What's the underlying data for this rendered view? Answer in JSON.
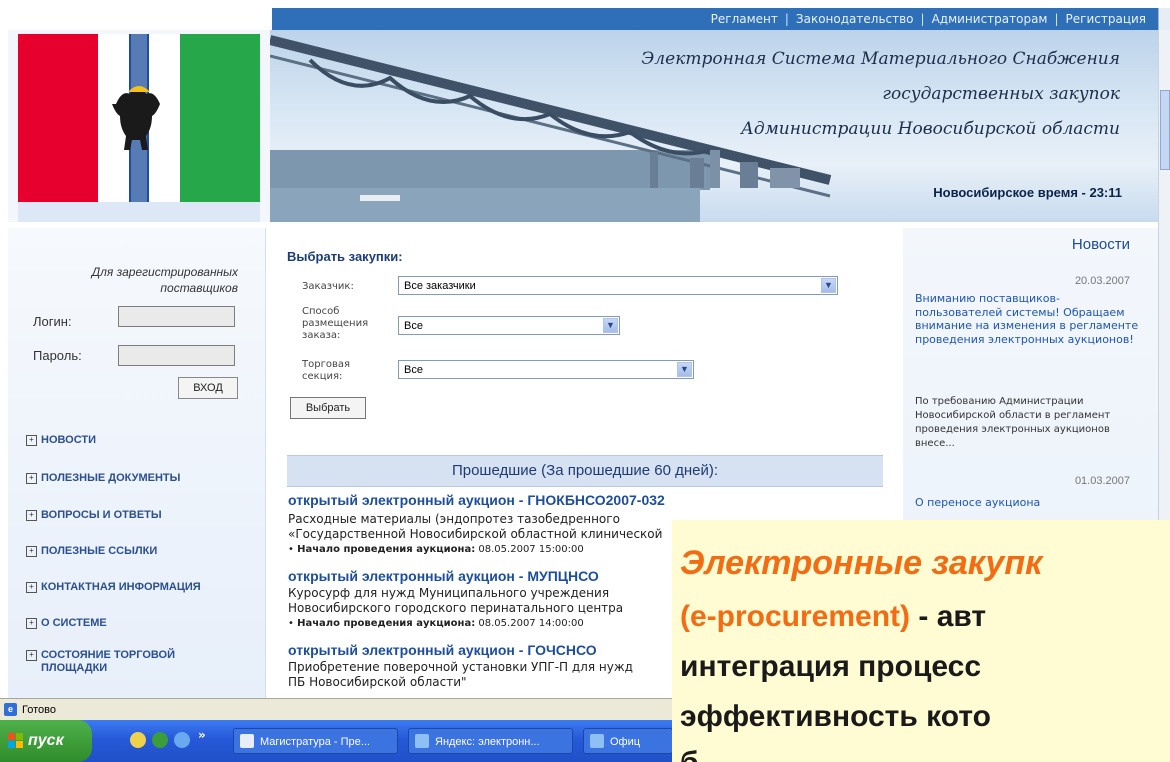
{
  "nav": {
    "links": [
      "Регламент",
      "Законодательство",
      "Администраторам",
      "Регистрация"
    ],
    "separator": "|"
  },
  "header": {
    "line1": "Электронная Система Материального Снабжения",
    "line2": "государственных закупок",
    "line3": "Администрации Новосибирской области",
    "clock": "Новосибирское время - 23:11"
  },
  "login": {
    "note": "Для зарегистрированных поставщиков",
    "login_label": "Логин:",
    "password_label": "Пароль:",
    "login_value": "",
    "password_value": "",
    "enter_button": "ВХОД"
  },
  "menu": [
    "НОВОСТИ",
    "ПОЛЕЗНЫЕ ДОКУМЕНТЫ",
    "ВОПРОСЫ И ОТВЕТЫ",
    "ПОЛЕЗНЫЕ ССЫЛКИ",
    "КОНТАКТНАЯ ИНФОРМАЦИЯ",
    "О СИСТЕМЕ",
    "СОСТОЯНИЕ ТОРГОВОЙ ПЛОЩАДКИ"
  ],
  "filter": {
    "title": "Выбрать закупки:",
    "customer_label": "Заказчик:",
    "customer_value": "Все заказчики",
    "method_label": "Способ размещения заказа:",
    "method_value": "Все",
    "section_label": "Торговая секция:",
    "section_value": "Все",
    "choose_button": "Выбрать"
  },
  "past": {
    "heading": "Прошедшие (За прошедшие 60 дней):",
    "start_label": "Начало проведения аукциона:",
    "auctions": [
      {
        "title": "открытый электронный аукцион - ГНОКБНСО2007-032",
        "desc1": "Расходные материалы (эндопротез тазобедренного",
        "desc2": "«Государственной Новосибирской областной клинической",
        "start": "08.05.2007 15:00:00"
      },
      {
        "title": "открытый электронный аукцион - МУПЦНСО",
        "desc1": "Куросурф для нужд Муниципального учреждения",
        "desc2": "Новосибирского городского перинатального центра",
        "start": "08.05.2007 14:00:00"
      },
      {
        "title": "открытый электронный аукцион - ГОЧСНСО",
        "desc1": "Приобретение поверочной установки УПГ-П для нужд",
        "desc2": "ПБ Новосибирской области\""
      }
    ]
  },
  "news": {
    "title": "Новости",
    "items": [
      {
        "date": "20.03.2007",
        "link": "Вниманию поставщиков-пользователей системы! Обращаем внимание на изменения в регламенте проведения электронных аукционов!",
        "body": "По требованию Администрации Новосибирской области в регламент проведения электронных аукционов внесе..."
      },
      {
        "date": "01.03.2007",
        "link": "О переносе аукциона"
      }
    ]
  },
  "status": {
    "text": "Готово"
  },
  "taskbar": {
    "start": "пуск",
    "more": "»",
    "tasks": [
      "Магистратура - Пре...",
      "Яндекс: электронн...",
      "Офиц"
    ]
  },
  "overlay": {
    "line1": "Электронные закупк",
    "line2_open": "(e-procurement)",
    "line2_rest": "- авт",
    "line3": "интеграция процесс",
    "line4": "эффективность кото",
    "line5": "б"
  },
  "colors": {
    "nav_bar": "#2f6fb8",
    "link_blue": "#1c4e9c",
    "overlay_bg": "#fffbd2",
    "overlay_accent": "#f36b12",
    "taskbar": "#2659d8",
    "start_green": "#3f9c39"
  }
}
